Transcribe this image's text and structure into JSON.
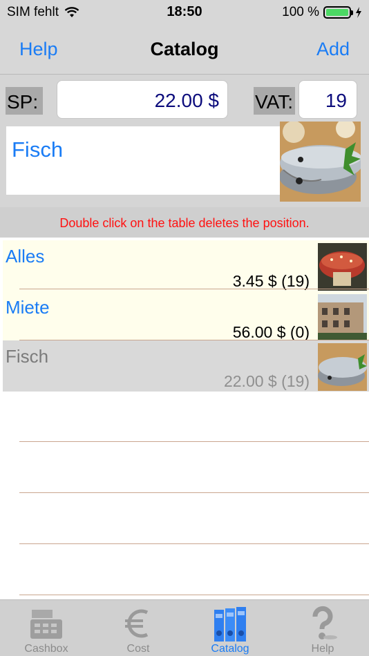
{
  "status_bar": {
    "carrier": "SIM fehlt",
    "time": "18:50",
    "battery_text": "100 %",
    "battery_level": 1.0
  },
  "nav": {
    "left": "Help",
    "title": "Catalog",
    "right": "Add"
  },
  "form": {
    "sp_label": "SP:",
    "sp_value": "22.00 $",
    "vat_label": "VAT:",
    "vat_value": "19",
    "name": "Fisch",
    "image": "fish-image"
  },
  "hint": "Double click on the table deletes the position.",
  "items": [
    {
      "name": "Alles",
      "price": "3.45 $ (19)",
      "image": "cake-image"
    },
    {
      "name": "Miete",
      "price": "56.00 $ (0)",
      "image": "building-image"
    },
    {
      "name": "Fisch",
      "price": "22.00 $ (19)",
      "image": "fish-image"
    }
  ],
  "tabs": [
    {
      "label": "Cashbox",
      "icon": "cash-register-icon"
    },
    {
      "label": "Cost",
      "icon": "euro-icon"
    },
    {
      "label": "Catalog",
      "icon": "binders-icon"
    },
    {
      "label": "Help",
      "icon": "question-icon"
    }
  ],
  "colors": {
    "accent": "#1a7cf5",
    "hint": "#ff1111",
    "row_highlight": "#fffeec",
    "row_selected": "#d9d9d9"
  }
}
